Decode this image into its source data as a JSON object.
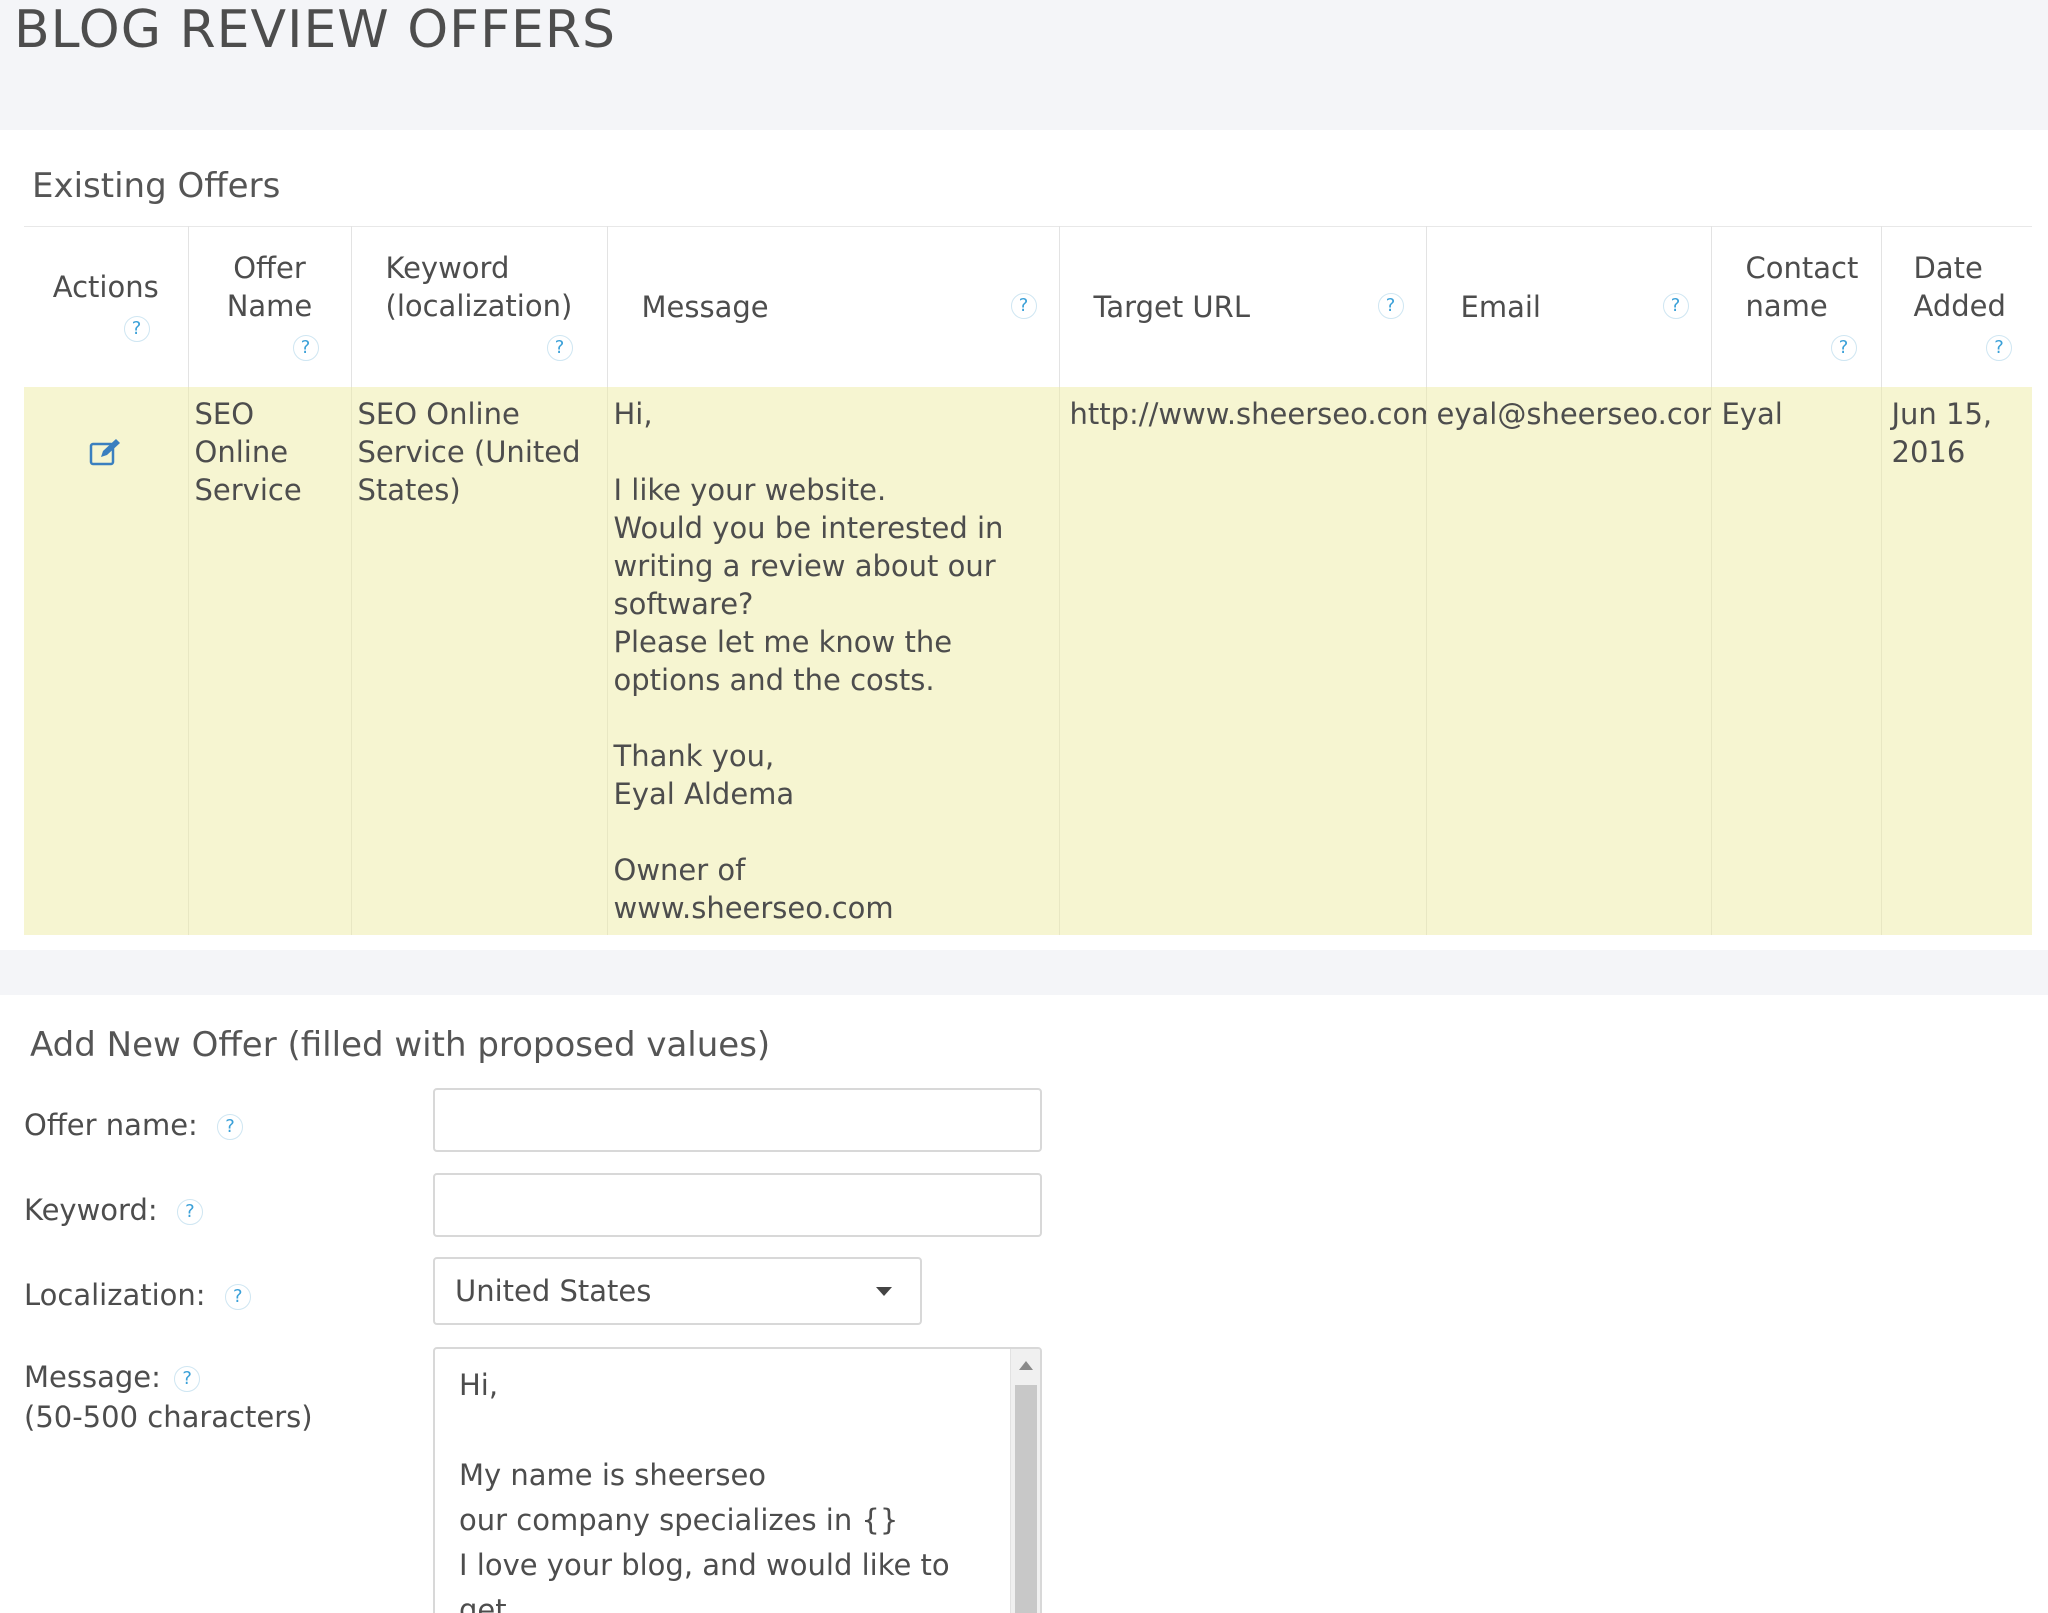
{
  "page": {
    "title": "BLOG REVIEW OFFERS"
  },
  "existing": {
    "title": "Existing Offers",
    "columns": {
      "actions": "Actions",
      "offer_name": "Offer Name",
      "keyword": "Keyword (localization)",
      "message": "Message",
      "target_url": "Target URL",
      "email": "Email",
      "contact_name": "Contact name",
      "date_added": "Date Added"
    },
    "help_glyph": "?",
    "rows": [
      {
        "offer_name": "SEO Online Service",
        "keyword": "SEO Online Service (United States)",
        "message": "Hi,\n\nI like your website.\nWould you be interested in writing a review about our software?\nPlease let me know the options and the costs.\n\nThank you,\nEyal Aldema\n\nOwner of\nwww.sheerseo.com",
        "target_url": "http://www.sheerseo.com",
        "email": "eyal@sheerseo.com",
        "contact_name": "Eyal",
        "date_added": "Jun 15, 2016",
        "action_icon": "edit-icon"
      }
    ]
  },
  "add_new": {
    "title": "Add New Offer (filled with proposed values)",
    "offer_name_label": "Offer name:",
    "offer_name_value": "",
    "keyword_label": "Keyword:",
    "keyword_value": "",
    "localization_label": "Localization:",
    "localization_value": "United States",
    "message_label": "Message:",
    "message_hint": "(50-500 characters)",
    "message_value": "Hi,\n\nMy name is sheerseo\nour company specializes in {}\nI love your blog, and would like to get\na review for our website."
  },
  "colors": {
    "highlight_row": "#f6f5d1",
    "help_icon": "#3aa0d8",
    "page_background": "#f4f5f8"
  }
}
